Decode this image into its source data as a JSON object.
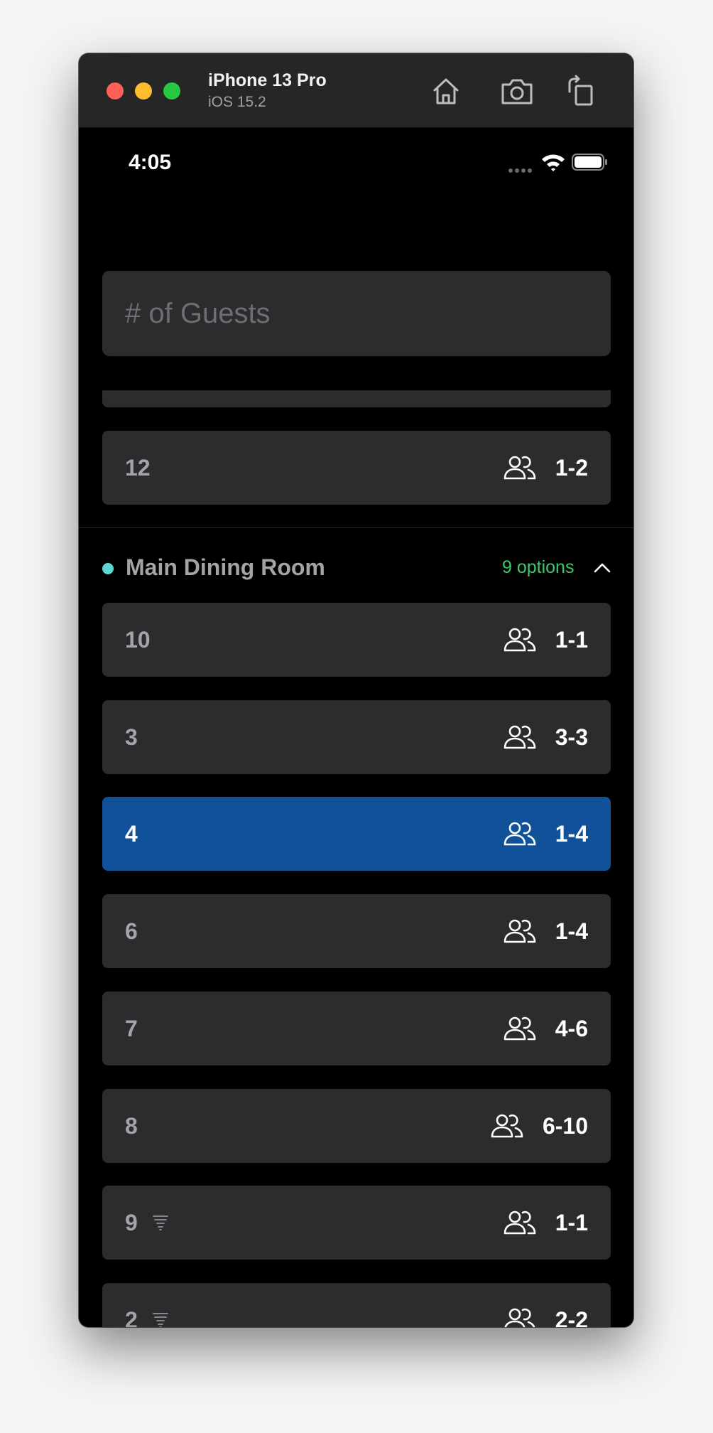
{
  "titlebar": {
    "device_name": "iPhone 13 Pro",
    "os_version": "iOS 15.2",
    "icons": [
      "home-icon",
      "screenshot-icon",
      "rotate-icon"
    ]
  },
  "status_bar": {
    "time": "4:05"
  },
  "guests_input": {
    "placeholder": "# of Guests",
    "value": ""
  },
  "previous_section_rows": [
    {
      "label": "12",
      "capacity": "1-2"
    }
  ],
  "section": {
    "title": "Main Dining Room",
    "dot_color": "#5ed8d4",
    "options": "9 options",
    "expanded": true,
    "rows": [
      {
        "label": "10",
        "capacity": "1-1",
        "selected": false,
        "has_tornado_icon": false
      },
      {
        "label": "3",
        "capacity": "3-3",
        "selected": false,
        "has_tornado_icon": false
      },
      {
        "label": "4",
        "capacity": "1-4",
        "selected": true,
        "has_tornado_icon": false
      },
      {
        "label": "6",
        "capacity": "1-4",
        "selected": false,
        "has_tornado_icon": false
      },
      {
        "label": "7",
        "capacity": "4-6",
        "selected": false,
        "has_tornado_icon": false
      },
      {
        "label": "8",
        "capacity": "6-10",
        "selected": false,
        "has_tornado_icon": false
      },
      {
        "label": "9",
        "capacity": "1-1",
        "selected": false,
        "has_tornado_icon": true
      },
      {
        "label": "2",
        "capacity": "2-2",
        "selected": false,
        "has_tornado_icon": true
      }
    ]
  },
  "colors": {
    "accent_selected": "#11519a",
    "options_green": "#3fc86a",
    "row_background": "#2c2c2e"
  }
}
